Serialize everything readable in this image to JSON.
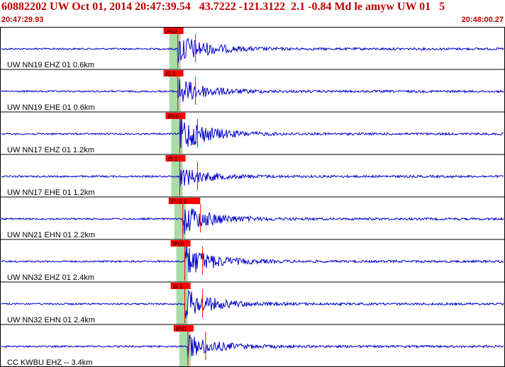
{
  "header": {
    "title": "60882202 UW Oct 01, 2014 20:47:39.54   43.7222 -121.3122  2.1 -0.84 Md le amyw UW 01   5",
    "start_time": "20:47:29.93",
    "end_time": "20:48:00.27"
  },
  "colors": {
    "frame": "#000000",
    "trace": "#0000cc",
    "pick": "#ff0000",
    "window": "#a8dca8",
    "text": "#c00000"
  },
  "channels": [
    {
      "label": "UW NN19 EHZ 01 0.6km",
      "pick": "iPc0",
      "amp": 0.9,
      "onset": 0.352
    },
    {
      "label": "UW NN19 EHE 01 0.6km",
      "pick": "iS 1",
      "amp": 0.75,
      "onset": 0.352
    },
    {
      "label": "UW NN17 EHZ 01 1.2km",
      "pick": "iPc0",
      "amp": 1.0,
      "onset": 0.356
    },
    {
      "label": "UW NN17 EHE 01 1.2km",
      "pick": "iS 1",
      "amp": 0.55,
      "onset": 0.356
    },
    {
      "label": "UW NN21 EHN 01 2.2km",
      "pick": "iP iS 1",
      "amp": 0.85,
      "onset": 0.362
    },
    {
      "label": "UW NN32 EHZ 01 2.4km",
      "pick": "iPc0",
      "amp": 0.9,
      "onset": 0.366
    },
    {
      "label": "UW NN32 EHN 01 2.4km",
      "pick": "iS 1",
      "amp": 0.8,
      "onset": 0.366
    },
    {
      "label": "CC KWBU EHZ -- 3.4km",
      "pick": "iPd1",
      "amp": 0.65,
      "onset": 0.372
    }
  ]
}
